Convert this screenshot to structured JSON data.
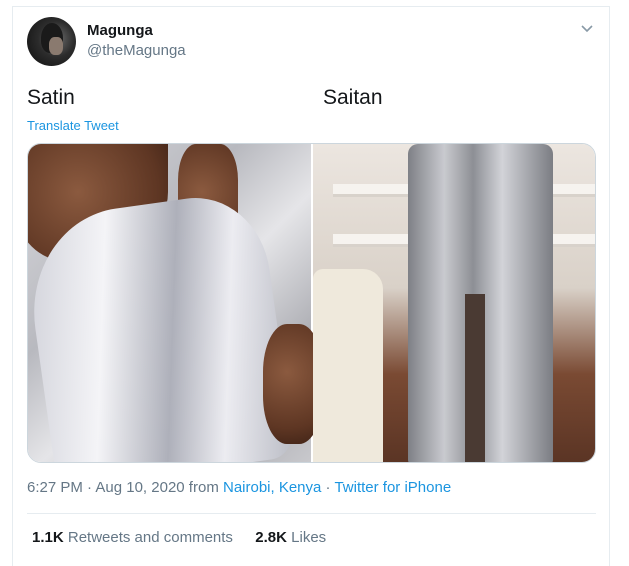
{
  "user": {
    "name": "Magunga",
    "handle": "@theMagunga"
  },
  "tweet": {
    "text_left": "Satin",
    "text_right": "Saitan",
    "translate_label": "Translate Tweet"
  },
  "meta": {
    "time": "6:27 PM",
    "sep1": " · ",
    "date": "Aug 10, 2020",
    "from": " from ",
    "location": "Nairobi, Kenya",
    "sep2": " · ",
    "client": "Twitter for iPhone"
  },
  "stats": {
    "retweets_count": "1.1K",
    "retweets_label": "Retweets and comments",
    "likes_count": "2.8K",
    "likes_label": "Likes"
  },
  "colors": {
    "link": "#1b95e0",
    "muted": "#657786",
    "text": "#14171a"
  },
  "icons": {
    "menu": "chevron-down-icon"
  }
}
